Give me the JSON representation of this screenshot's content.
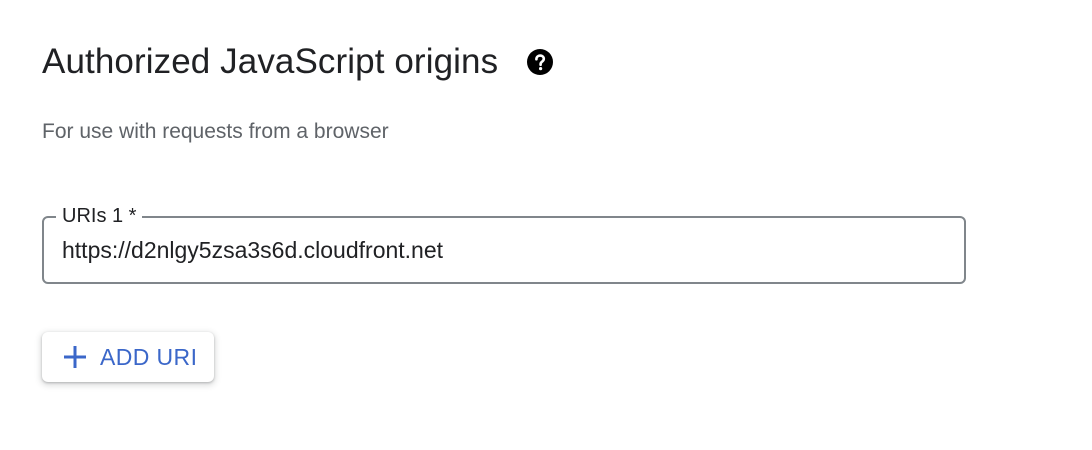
{
  "section": {
    "title": "Authorized JavaScript origins",
    "help_icon": "help-circle-icon",
    "subtitle": "For use with requests from a browser"
  },
  "uri_field": {
    "label": "URIs 1 *",
    "value": "https://d2nlgy5zsa3s6d.cloudfront.net"
  },
  "add_button": {
    "icon": "plus-icon",
    "label": "ADD URI"
  },
  "colors": {
    "accent": "#3b67c9",
    "text_primary": "#202124",
    "text_secondary": "#5f6368",
    "border": "#80868b"
  }
}
